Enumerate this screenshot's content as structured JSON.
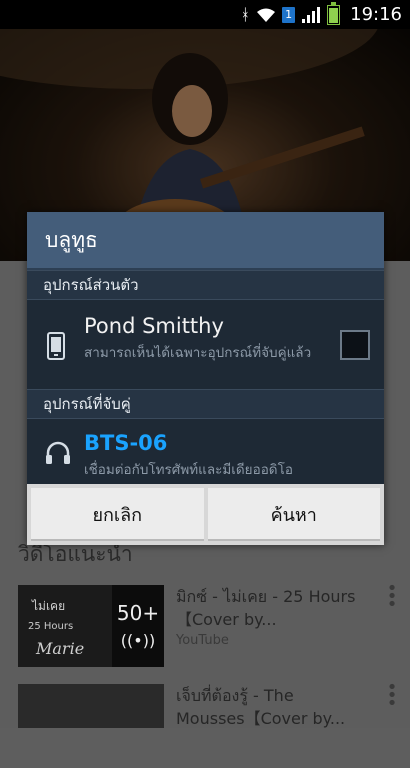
{
  "status_bar": {
    "time": "19:16",
    "sim_label": "1",
    "icons": [
      "bluetooth-icon",
      "wifi-icon",
      "sim-badge",
      "signal-icon",
      "battery-icon"
    ]
  },
  "background": {
    "section_title": "วิดีโอแนะนำ",
    "recommended": [
      {
        "title": "มิกซ์ - ไม่เคย - 25 Hours【Cover by...",
        "channel": "YouTube",
        "thumb_text_top": "ไม่เคย",
        "thumb_text_mid": "25 Hours",
        "thumb_text_script": "Marie",
        "playlist_count": "50+"
      },
      {
        "title": "เจ็บที่ต้องรู้ - The Mousses【Cover by...",
        "channel": ""
      }
    ]
  },
  "dialog": {
    "title": "บลูทูธ",
    "personal_section": "อุปกรณ์ส่วนตัว",
    "personal_device": {
      "name": "Pond Smitthy",
      "subtitle": "สามารถเห็นได้เฉพาะอุปกรณ์ที่จับคู่แล้ว",
      "checked": false
    },
    "paired_section": "อุปกรณ์ที่จับคู่",
    "paired_device": {
      "name": "BTS-06",
      "subtitle": "เชื่อมต่อกับโทรศัพท์และมีเดียออดิโอ"
    },
    "cancel_label": "ยกเลิก",
    "scan_label": "ค้นหา",
    "accent_color": "#1aa3ff"
  }
}
